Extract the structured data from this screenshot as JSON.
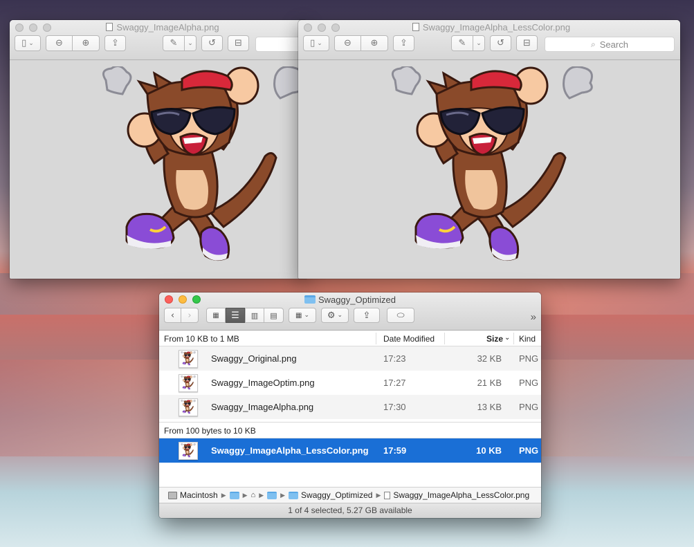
{
  "preview_left": {
    "title": "Swaggy_ImageAlpha.png"
  },
  "preview_right": {
    "title": "Swaggy_ImageAlpha_LessColor.png",
    "search_placeholder": "Search"
  },
  "toolbar_icons": [
    "sidebar-icon",
    "zoom-out-icon",
    "zoom-in-icon",
    "share-icon",
    "markup-pen-icon",
    "rotate-icon",
    "toolbox-icon"
  ],
  "finder": {
    "title": "Swaggy_Optimized",
    "columns": {
      "name": "From 10 KB to 1 MB",
      "date": "Date Modified",
      "size": "Size",
      "kind": "Kind"
    },
    "group1": {
      "rows": [
        {
          "name": "Swaggy_Original.png",
          "date": "17:23",
          "size": "32 KB",
          "kind": "PNG"
        },
        {
          "name": "Swaggy_ImageOptim.png",
          "date": "17:27",
          "size": "21 KB",
          "kind": "PNG"
        },
        {
          "name": "Swaggy_ImageAlpha.png",
          "date": "17:30",
          "size": "13 KB",
          "kind": "PNG"
        }
      ]
    },
    "group2": {
      "label": "From 100 bytes to 10 KB",
      "rows": [
        {
          "name": "Swaggy_ImageAlpha_LessColor.png",
          "date": "17:59",
          "size": "10 KB",
          "kind": "PNG",
          "selected": true
        }
      ]
    },
    "path": {
      "disk": "Macintosh",
      "folder": "Swaggy_Optimized",
      "file": "Swaggy_ImageAlpha_LessColor.png"
    },
    "status": "1 of 4 selected, 5.27 GB available",
    "more_glyph": "»",
    "sort_glyph": "⌄"
  }
}
